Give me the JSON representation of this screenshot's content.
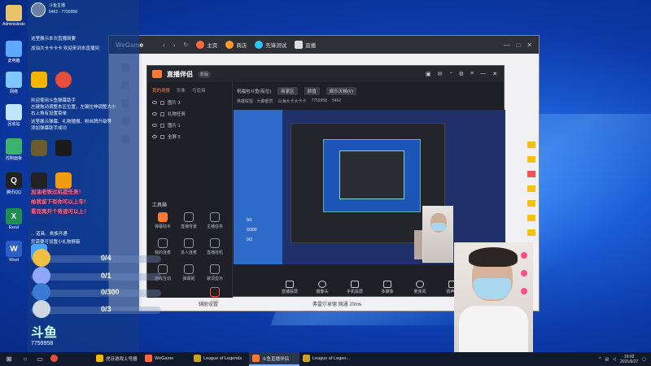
{
  "desktop_icons": [
    {
      "label": "Administrator",
      "color": "#e9c46a"
    },
    {
      "label": "此电脑",
      "color": "#5fa8ff"
    },
    {
      "label": "网络",
      "color": "#7fc8ff"
    },
    {
      "label": "回收站",
      "color": "#bfe6ff"
    },
    {
      "label": "控制面板",
      "color": "#3bb36a"
    },
    {
      "label": "腾讯QQ",
      "color": "#222222"
    },
    {
      "label": "Excel",
      "color": "#1e8f4e"
    },
    {
      "label": "Word",
      "color": "#2b5fc7"
    }
  ],
  "overlay": {
    "host_name": "斗鱼主播",
    "stats": "5462 · 7759958",
    "messages": [
      "这里展示本次直播简要",
      "  加油大卡卡卡卡  欢迎来到本直播间",
      "欢迎使用斗鱼弹幕助手",
      "左键拖动调整本区位置，左键拉伸调整大小",
      "右上角有设置菜单",
      "这里展示弹幕、礼物播报、粉丝牌升级等",
      "添加弹幕助手成功"
    ],
    "danmu": [
      "加油老铁过机提任务！",
      "给我留下有你可以上车！",
      "看完再开个奇迹可以上！"
    ],
    "extra_msg": "  ... 道具、贵族开通",
    "extra_msg2": "您需要可设置小礼物屏蔽",
    "tasks": [
      {
        "value": "0/4",
        "color": "#f0c040"
      },
      {
        "value": "0/1",
        "color": "#8fa8ff"
      },
      {
        "value": "0/300",
        "color": "#3a7bd5"
      },
      {
        "value": "0/3",
        "color": "#cfd6e6"
      }
    ],
    "logo": "斗鱼",
    "room_id": "7759958",
    "apps": [
      "#f5b400",
      "#e74c3c",
      "#3cc4ff",
      "#f7c500",
      "#ffffff",
      "#222222",
      "#ff8a00"
    ]
  },
  "wegame": {
    "logo": "WeGame",
    "tabs": [
      {
        "label": "主页",
        "color": "#ff6a3d"
      },
      {
        "label": "商店",
        "color": "#ff9a2e"
      },
      {
        "label": "先锋测试",
        "color": "#2ec4ff"
      },
      {
        "label": "直播",
        "color": "#dddddd"
      }
    ],
    "bottom_left": "辅助设置",
    "bottom_right": "弗雷尔卓德 网通  20ms"
  },
  "zhibo": {
    "title": "直播伴侣",
    "version": "新版",
    "left_tabs": [
      "我的场景",
      "形象",
      "可道具"
    ],
    "scenes": [
      "图片 3",
      "礼物任务",
      "图片 1",
      "全屏 5"
    ],
    "tools_title": "工具箱",
    "tools": [
      "弹幕助手",
      "直播背景",
      "主播任务",
      "我的连麦",
      "多人连麦",
      "直播挂机",
      "游戏互动",
      "弹幕姬",
      "歌词显示",
      "贴纸"
    ],
    "room_title": "祝福包斗鱼(有位)",
    "room_tag1": "商家区",
    "room_tag2": "颜值",
    "room_tag3": "娱乐天梯(V)",
    "subinfo": [
      "英雄联盟 · 大聚都赏",
      "山海大卡大卡卡",
      "7759958",
      "5462"
    ],
    "preview_vals": [
      "0/1",
      "0/300",
      "0/3"
    ],
    "controls": [
      "直播投屏",
      "摄像头",
      "手机投屏",
      "多媒体",
      "麦克风",
      "扬声器"
    ]
  },
  "taskbar": {
    "items": [
      {
        "label": "WeGame",
        "color": "#ff6a3d"
      },
      {
        "label": "League of Legends",
        "color": "#c9a227"
      },
      {
        "label": "斗鱼直播伴侣",
        "color": "#ff7a2e"
      },
      {
        "label": "League of Legen...",
        "color": "#c9a227"
      }
    ],
    "first_item": "虎牙游戏上号器",
    "time": "19:02",
    "date": "2021/6/27"
  }
}
